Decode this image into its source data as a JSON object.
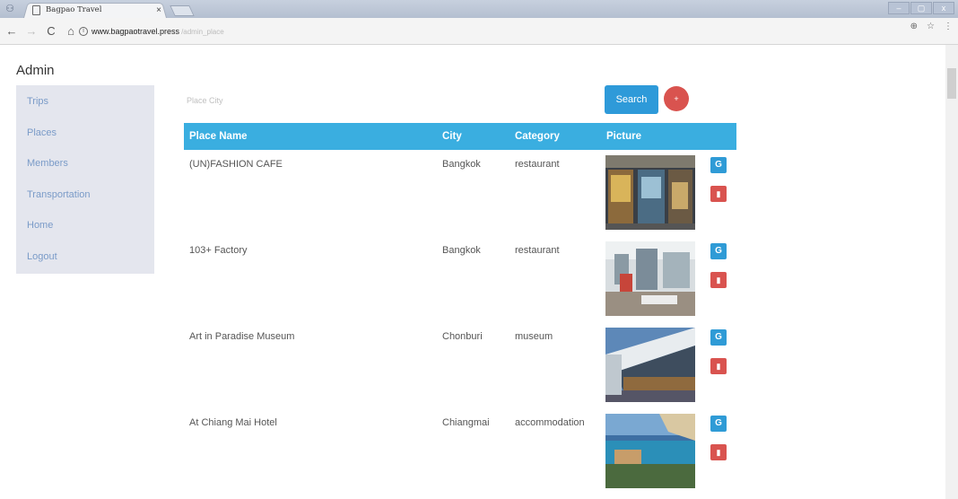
{
  "browser": {
    "tab_title": "Bagpao Travel",
    "tab_close": "×",
    "url_host": "www.bagpaotravel.press",
    "url_path": "/admin_place",
    "win_controls": [
      "–",
      "▢",
      "x"
    ]
  },
  "admin_title": "Admin",
  "sidebar": {
    "items": [
      {
        "label": "Trips"
      },
      {
        "label": "Places"
      },
      {
        "label": "Members"
      },
      {
        "label": "Transportation"
      },
      {
        "label": "Home"
      },
      {
        "label": "Logout"
      }
    ]
  },
  "search": {
    "placeholder": "Place City",
    "button_label": "Search",
    "add_label": "+"
  },
  "table": {
    "headers": {
      "name": "Place Name",
      "city": "City",
      "category": "Category",
      "picture": "Picture"
    },
    "rows": [
      {
        "name": "(UN)FASHION CAFE",
        "city": "Bangkok",
        "category": "restaurant",
        "picture": "cafe-storefront"
      },
      {
        "name": "103+ Factory",
        "city": "Bangkok",
        "category": "restaurant",
        "picture": "factory-interior"
      },
      {
        "name": "Art in Paradise Museum",
        "city": "Chonburi",
        "category": "museum",
        "picture": "museum-building"
      },
      {
        "name": "At Chiang Mai Hotel",
        "city": "Chiangmai",
        "category": "accommodation",
        "picture": "hotel-pool"
      }
    ]
  },
  "colors": {
    "header_bg": "#3aaee0",
    "search_btn": "#2e9ad9",
    "add_btn": "#d9534f",
    "edit_btn": "#2f9bd6",
    "delete_btn": "#d9534f",
    "sidebar_bg": "#e4e6ee",
    "sidebar_link": "#7a9bc8"
  },
  "icons": {
    "edit": "edit-icon",
    "delete": "trash-icon"
  }
}
